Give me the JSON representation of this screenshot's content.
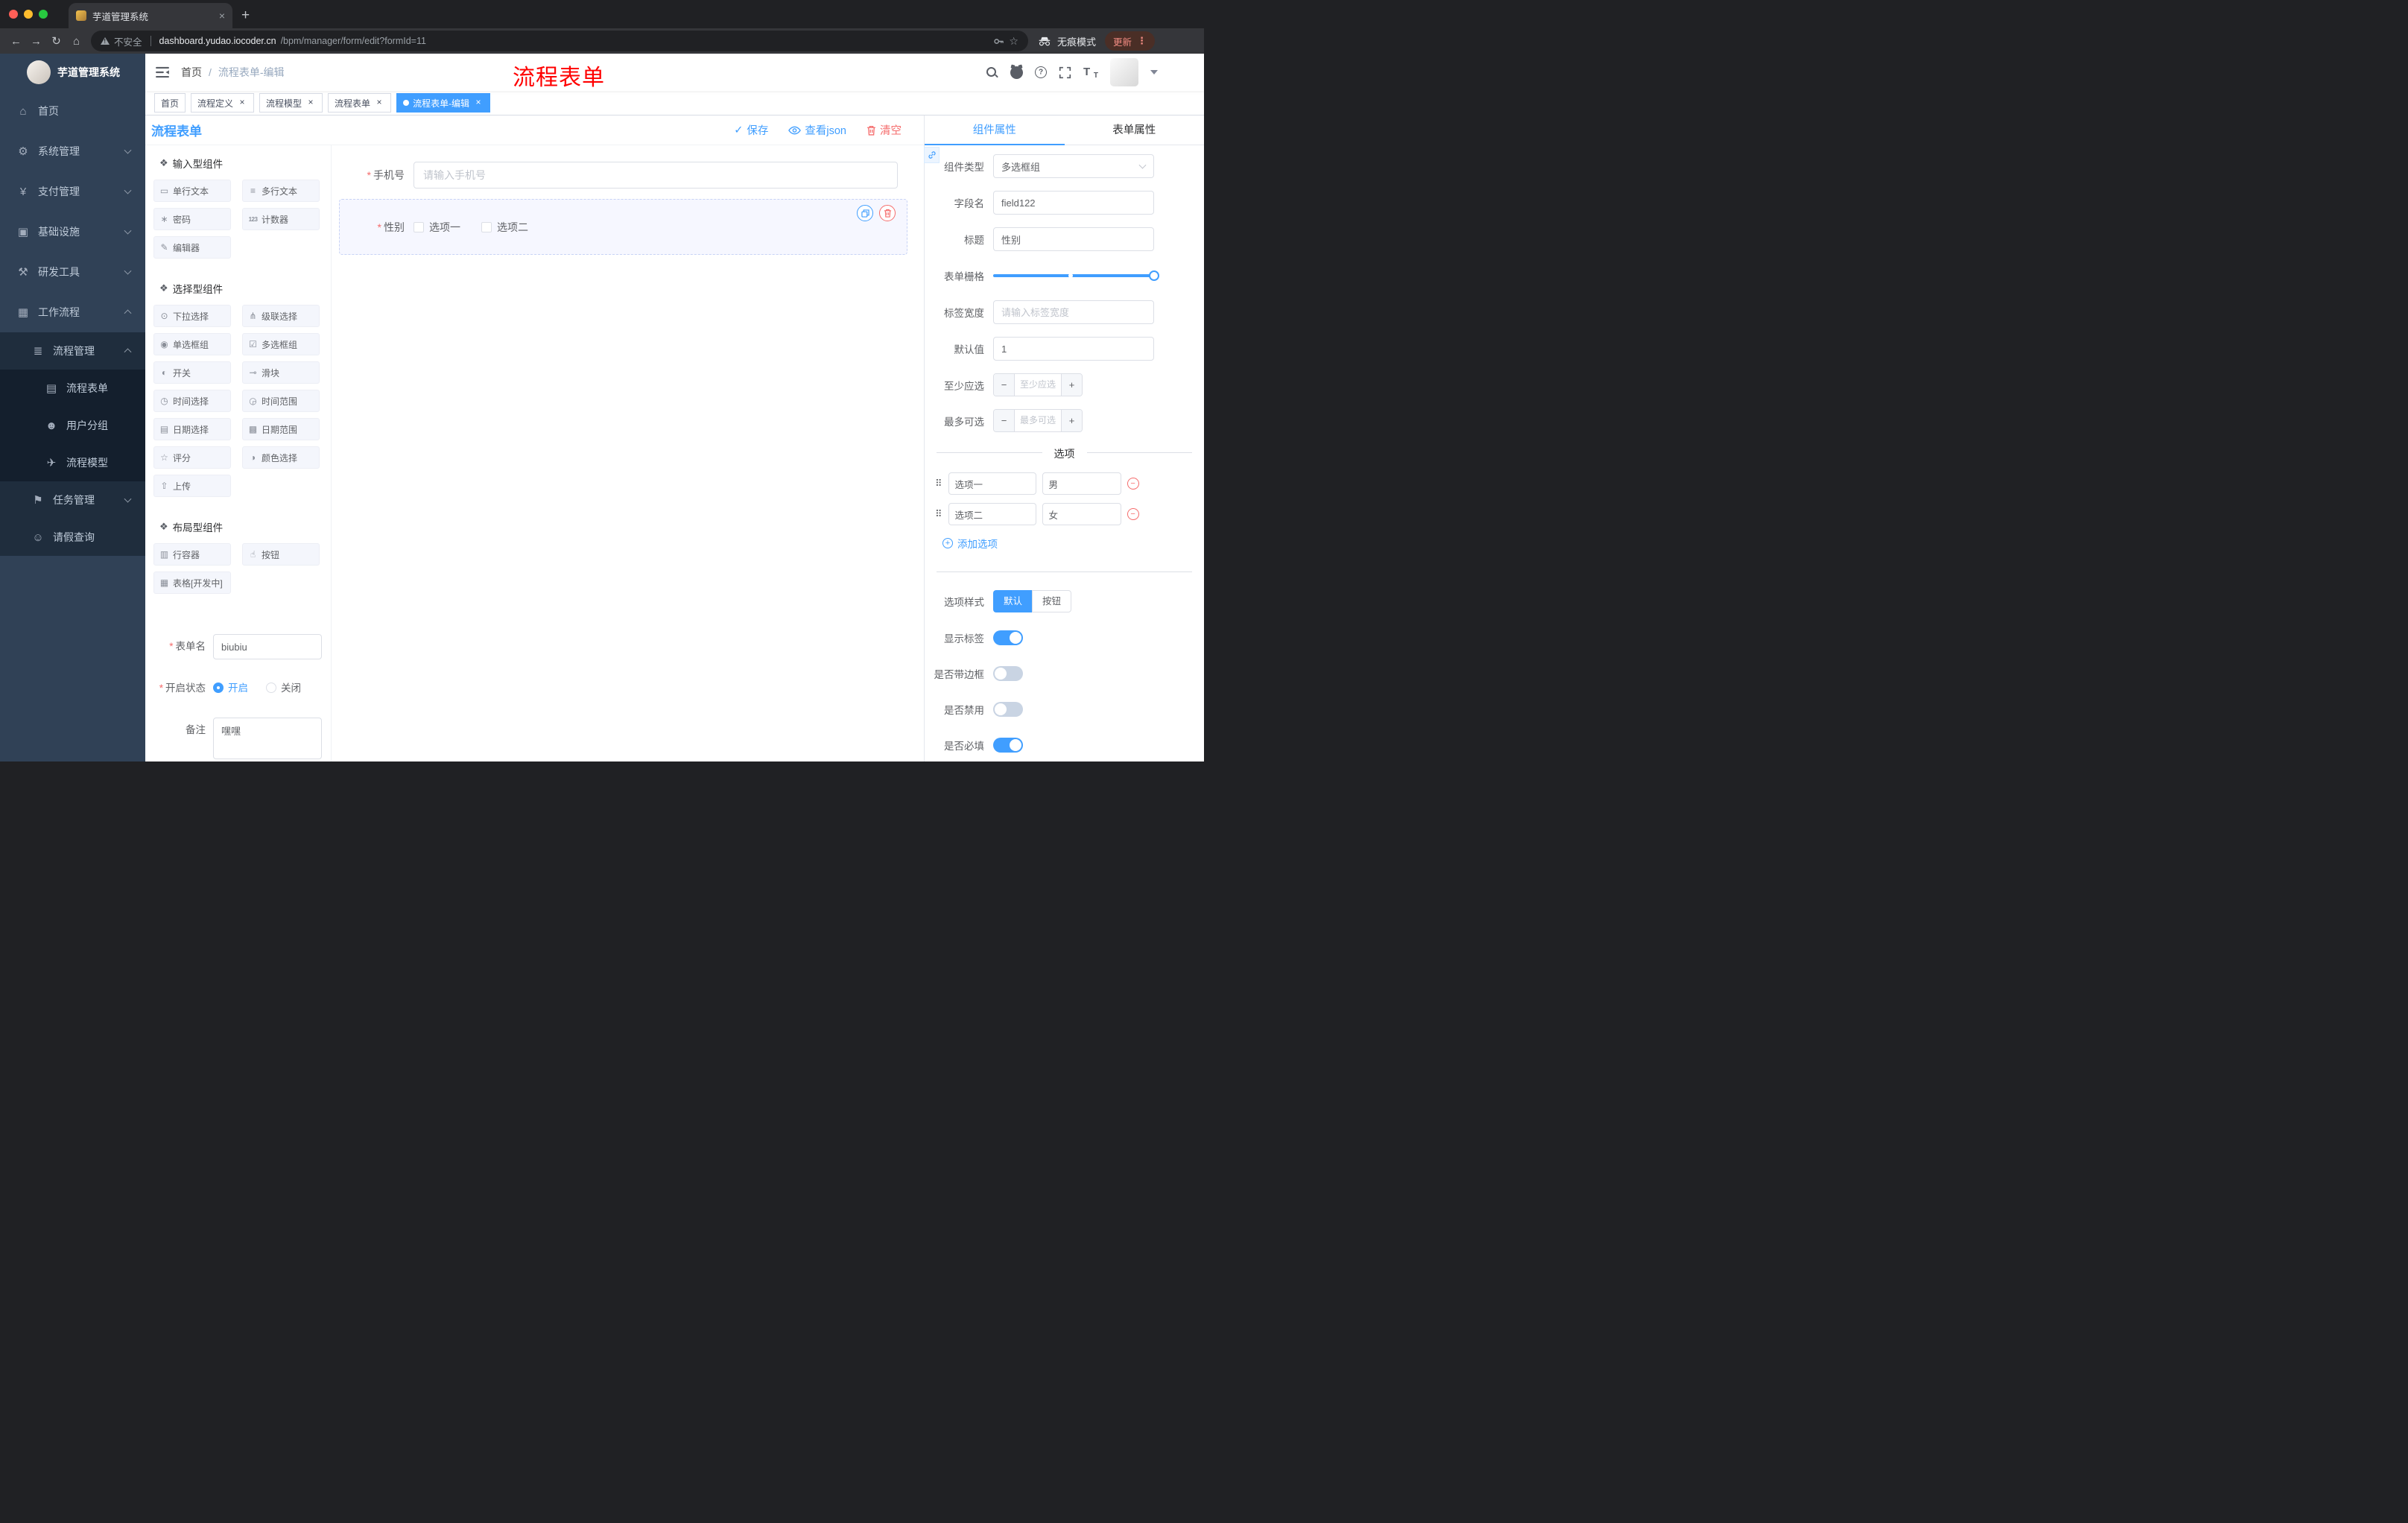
{
  "colors": {
    "accent": "#409EFF",
    "danger": "#F56C6C",
    "annotation": "#FF0000"
  },
  "browser": {
    "tab": {
      "title": "芋道管理系统"
    },
    "address": {
      "security_label": "不安全",
      "url_host": "dashboard.yudao.iocoder.cn",
      "url_path": "/bpm/manager/form/edit?formId=11"
    },
    "incognito_label": "无痕模式",
    "update_label": "更新"
  },
  "sidebar": {
    "logo_title": "芋道管理系统",
    "menu": [
      {
        "key": "home",
        "label": "首页",
        "icon": "home-icon",
        "level": 1
      },
      {
        "key": "system-management",
        "label": "系统管理",
        "icon": "gear-icon",
        "level": 1,
        "expandable": true,
        "open": false
      },
      {
        "key": "payment-management",
        "label": "支付管理",
        "icon": "yen-icon",
        "level": 1,
        "expandable": true,
        "open": false
      },
      {
        "key": "infrastructure",
        "label": "基础设施",
        "icon": "infrastructure-icon",
        "level": 1,
        "expandable": true,
        "open": false
      },
      {
        "key": "dev-tools",
        "label": "研发工具",
        "icon": "tools-icon",
        "level": 1,
        "expandable": true,
        "open": false
      },
      {
        "key": "workflow",
        "label": "工作流程",
        "icon": "workflow-icon",
        "level": 1,
        "expandable": true,
        "open": true
      },
      {
        "key": "process-management",
        "label": "流程管理",
        "icon": "process-list-icon",
        "level": 2,
        "expandable": true,
        "open": true
      },
      {
        "key": "process-form",
        "label": "流程表单",
        "icon": "form-doc-icon",
        "level": 3
      },
      {
        "key": "user-group",
        "label": "用户分组",
        "icon": "user-group-icon",
        "level": 3
      },
      {
        "key": "process-model",
        "label": "流程模型",
        "icon": "paper-plane-icon",
        "level": 3
      },
      {
        "key": "task-management",
        "label": "任务管理",
        "icon": "task-icon",
        "level": 2,
        "expandable": true,
        "open": false
      },
      {
        "key": "leave-query",
        "label": "请假查询",
        "icon": "person-icon",
        "level": 2
      }
    ]
  },
  "header": {
    "breadcrumb": [
      "首页",
      "流程表单-编辑"
    ],
    "annotation": "流程表单"
  },
  "tags": [
    {
      "key": "home",
      "label": "首页",
      "closable": false,
      "active": false
    },
    {
      "key": "process-definition",
      "label": "流程定义",
      "closable": true,
      "active": false
    },
    {
      "key": "process-model",
      "label": "流程模型",
      "closable": true,
      "active": false
    },
    {
      "key": "process-form",
      "label": "流程表单",
      "closable": true,
      "active": false
    },
    {
      "key": "process-form-edit",
      "label": "流程表单-编辑",
      "closable": true,
      "active": true
    }
  ],
  "editor": {
    "title": "流程表单",
    "toolbar": {
      "save_label": "保存",
      "view_json_label": "查看json",
      "clear_label": "清空"
    },
    "component_groups": [
      {
        "key": "input-components",
        "title": "输入型组件",
        "items": [
          {
            "key": "single-line-text",
            "label": "单行文本",
            "icon": "single-line-icon"
          },
          {
            "key": "multi-line-text",
            "label": "多行文本",
            "icon": "multi-line-icon"
          },
          {
            "key": "password",
            "label": "密码",
            "icon": "lock-icon"
          },
          {
            "key": "counter",
            "label": "计数器",
            "icon": "counter-icon"
          },
          {
            "key": "editor",
            "label": "编辑器",
            "icon": "editor-icon"
          }
        ]
      },
      {
        "key": "select-components",
        "title": "选择型组件",
        "items": [
          {
            "key": "select",
            "label": "下拉选择",
            "icon": "select-icon"
          },
          {
            "key": "cascader",
            "label": "级联选择",
            "icon": "cascader-icon"
          },
          {
            "key": "radio-group",
            "label": "单选框组",
            "icon": "radio-group-icon"
          },
          {
            "key": "checkbox-group",
            "label": "多选框组",
            "icon": "checkbox-group-icon"
          },
          {
            "key": "switch",
            "label": "开关",
            "icon": "switch-icon"
          },
          {
            "key": "slider",
            "label": "滑块",
            "icon": "slider-icon"
          },
          {
            "key": "time-picker",
            "label": "时间选择",
            "icon": "time-icon"
          },
          {
            "key": "time-range",
            "label": "时间范围",
            "icon": "time-range-icon"
          },
          {
            "key": "date-picker",
            "label": "日期选择",
            "icon": "date-icon"
          },
          {
            "key": "date-range",
            "label": "日期范围",
            "icon": "date-range-icon"
          },
          {
            "key": "rate",
            "label": "评分",
            "icon": "rate-icon"
          },
          {
            "key": "color-picker",
            "label": "颜色选择",
            "icon": "color-icon"
          },
          {
            "key": "upload",
            "label": "上传",
            "icon": "upload-icon"
          }
        ]
      },
      {
        "key": "layout-components",
        "title": "布局型组件",
        "items": [
          {
            "key": "row-container",
            "label": "行容器",
            "icon": "row-icon"
          },
          {
            "key": "button",
            "label": "按钮",
            "icon": "button-icon"
          },
          {
            "key": "table",
            "label": "表格[开发中]",
            "icon": "table-icon"
          }
        ]
      }
    ],
    "form_meta": {
      "name_label": "表单名",
      "name_value": "biubiu",
      "status_label": "开启状态",
      "status_options": [
        "开启",
        "关闭"
      ],
      "status_selected": "开启",
      "remark_label": "备注",
      "remark_value": "嘿嘿"
    },
    "canvas": {
      "phone": {
        "label": "手机号",
        "required": true,
        "placeholder": "请输入手机号"
      },
      "gender": {
        "label": "性别",
        "required": true,
        "options": [
          "选项一",
          "选项二"
        ],
        "selected": true
      }
    },
    "properties": {
      "tabs": [
        "组件属性",
        "表单属性"
      ],
      "active_tab": "组件属性",
      "component_type_label": "组件类型",
      "component_type_value": "多选框组",
      "field_name_label": "字段名",
      "field_name_value": "field122",
      "title_label": "标题",
      "title_value": "性别",
      "grid_label": "表单栅格",
      "label_width_label": "标签宽度",
      "label_width_placeholder": "请输入标签宽度",
      "default_value_label": "默认值",
      "default_value": "1",
      "min_select_label": "至少应选",
      "min_select_placeholder": "至少应选",
      "max_select_label": "最多可选",
      "max_select_placeholder": "最多可选",
      "options_title": "选项",
      "options": [
        {
          "label": "选项一",
          "value": "男"
        },
        {
          "label": "选项二",
          "value": "女"
        }
      ],
      "add_option_label": "添加选项",
      "option_style_label": "选项样式",
      "option_style_choices": [
        "默认",
        "按钮"
      ],
      "option_style_selected": "默认",
      "switches": [
        {
          "key": "show-label",
          "label": "显示标签",
          "on": true
        },
        {
          "key": "border",
          "label": "是否带边框",
          "on": false
        },
        {
          "key": "disabled",
          "label": "是否禁用",
          "on": false
        },
        {
          "key": "required",
          "label": "是否必填",
          "on": true
        }
      ]
    }
  }
}
